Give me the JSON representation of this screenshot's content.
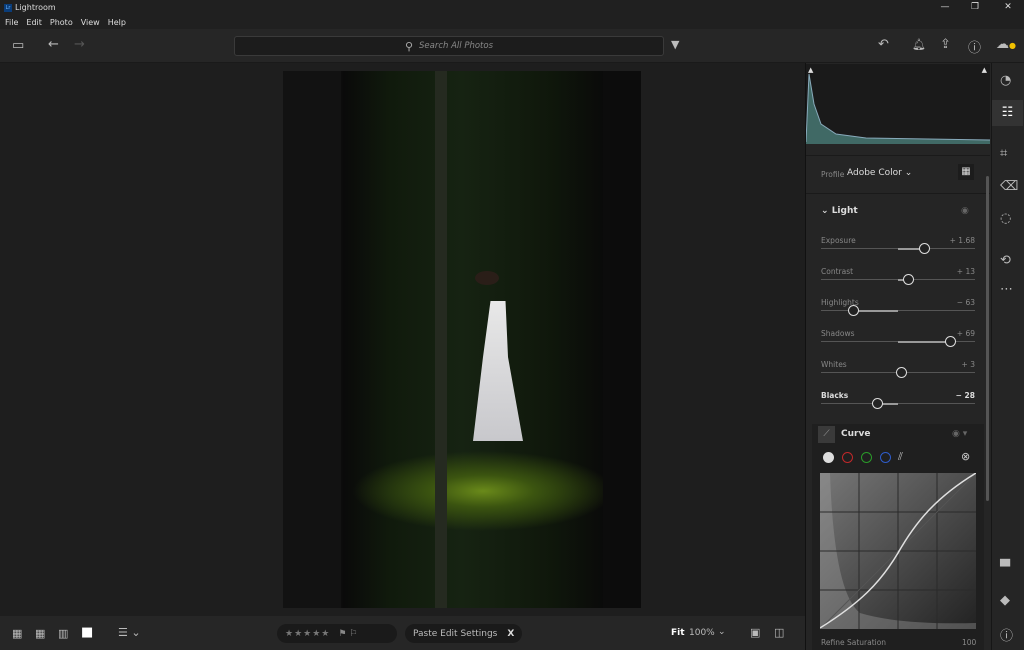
{
  "window": {
    "title": "Lightroom",
    "logo": "Lr",
    "minimize": "—",
    "restore": "❐",
    "close": "✕"
  },
  "menu": [
    "File",
    "Edit",
    "Photo",
    "View",
    "Help"
  ],
  "toolbar": {
    "search_placeholder": "Search All Photos",
    "icons": [
      "panel-toggle-icon",
      "back-arrow-icon",
      "forward-arrow-icon",
      "filter-icon",
      "undo-icon",
      "bell-icon",
      "share-icon",
      "help-icon",
      "cloud-sync-icon"
    ]
  },
  "profile": {
    "label": "Profile",
    "value": "Adobe Color"
  },
  "light": {
    "title": "Light",
    "sliders": [
      {
        "label": "Exposure",
        "value": "+ 1.68",
        "pos": 0.67,
        "active": false
      },
      {
        "label": "Contrast",
        "value": "+ 13",
        "pos": 0.57,
        "active": false
      },
      {
        "label": "Highlights",
        "value": "− 63",
        "pos": 0.21,
        "active": false
      },
      {
        "label": "Shadows",
        "value": "+ 69",
        "pos": 0.84,
        "active": false
      },
      {
        "label": "Whites",
        "value": "+ 3",
        "pos": 0.52,
        "active": false
      },
      {
        "label": "Blacks",
        "value": "− 28",
        "pos": 0.37,
        "active": true
      }
    ]
  },
  "curve": {
    "title": "Curve",
    "channels": [
      {
        "name": "rgb",
        "color": "#dddddd"
      },
      {
        "name": "red",
        "color": "#c0282a"
      },
      {
        "name": "green",
        "color": "#2a9a2a"
      },
      {
        "name": "blue",
        "color": "#2e5bc9"
      }
    ],
    "refine_label": "Refine Saturation",
    "refine_value": "100"
  },
  "bottom": {
    "paste": "Paste Edit Settings",
    "close": "X",
    "zoom_fit": "Fit",
    "zoom_value": "100%",
    "stars": "★★★★★",
    "flags": "⚑ ⚐"
  }
}
